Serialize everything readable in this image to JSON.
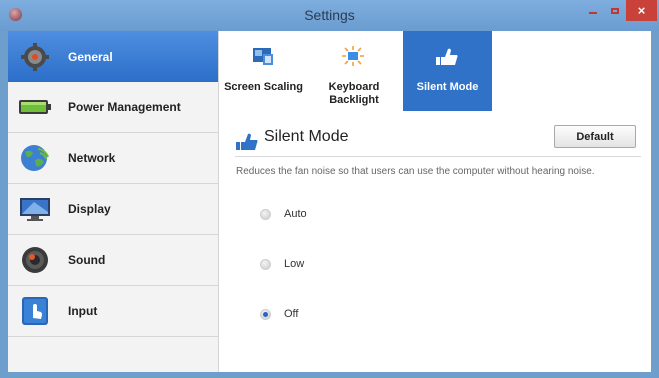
{
  "window": {
    "title": "Settings",
    "close_label": "×"
  },
  "sidebar": {
    "items": [
      {
        "label": "General",
        "icon": "gear-icon",
        "active": true
      },
      {
        "label": "Power Management",
        "icon": "battery-icon",
        "active": false
      },
      {
        "label": "Network",
        "icon": "globe-icon",
        "active": false
      },
      {
        "label": "Display",
        "icon": "display-icon",
        "active": false
      },
      {
        "label": "Sound",
        "icon": "speaker-icon",
        "active": false
      },
      {
        "label": "Input",
        "icon": "touch-icon",
        "active": false
      }
    ]
  },
  "tabs": [
    {
      "label": "Screen Scaling",
      "icon": "screen-scaling-icon",
      "active": false
    },
    {
      "label": "Keyboard Backlight",
      "icon": "backlight-icon",
      "active": false
    },
    {
      "label": "Silent Mode",
      "icon": "silent-mode-icon",
      "active": true
    }
  ],
  "section": {
    "title": "Silent Mode",
    "default_button": "Default",
    "description": "Reduces the fan noise so that users can use the computer without hearing noise."
  },
  "options": [
    {
      "label": "Auto",
      "checked": false
    },
    {
      "label": "Low",
      "checked": false
    },
    {
      "label": "Off",
      "checked": true
    }
  ],
  "colors": {
    "accent": "#2f72c8",
    "titlebar": "#6e9fcc",
    "close": "#c9423a"
  }
}
